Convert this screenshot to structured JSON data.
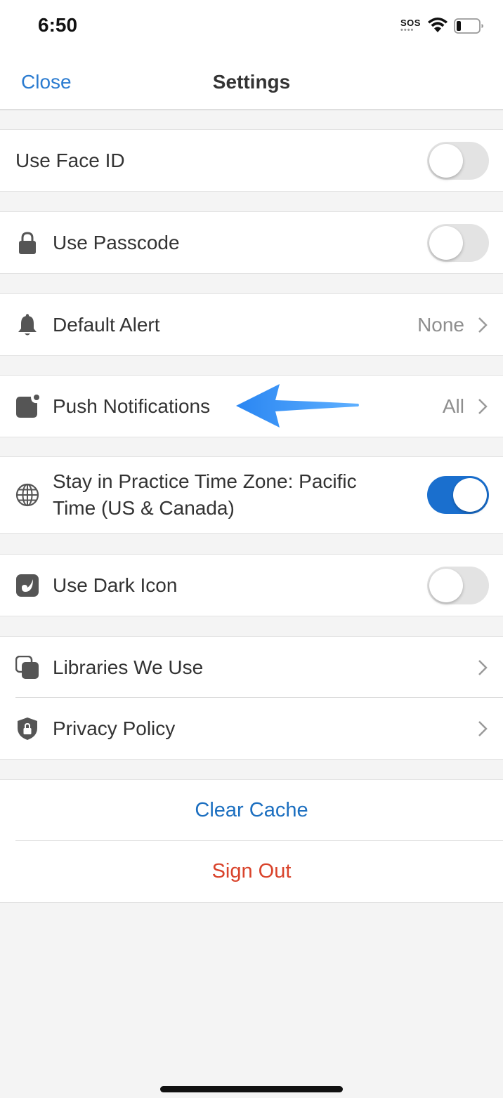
{
  "status": {
    "time": "6:50",
    "sos": "SOS",
    "battery_level": 0.2
  },
  "nav": {
    "close_label": "Close",
    "title": "Settings"
  },
  "settings": {
    "face_id": {
      "label": "Use Face ID",
      "enabled": false
    },
    "passcode": {
      "label": "Use Passcode",
      "icon": "lock-icon",
      "enabled": false
    },
    "default_alert": {
      "label": "Default Alert",
      "icon": "bell-icon",
      "value": "None"
    },
    "push_notifications": {
      "label": "Push Notifications",
      "icon": "notification-badge-icon",
      "value": "All"
    },
    "time_zone": {
      "label": "Stay in Practice Time Zone: Pacific Time (US & Canada)",
      "icon": "globe-icon",
      "enabled": true
    },
    "dark_icon": {
      "label": "Use Dark Icon",
      "icon": "app-icon",
      "enabled": false
    },
    "libraries": {
      "label": "Libraries We Use",
      "icon": "stacked-squares-icon"
    },
    "privacy": {
      "label": "Privacy Policy",
      "icon": "shield-lock-icon"
    }
  },
  "actions": {
    "clear_cache": "Clear Cache",
    "sign_out": "Sign Out"
  },
  "colors": {
    "accent": "#2a7bd0",
    "toggle_on": "#1a6fce",
    "destructive": "#d9432b",
    "arrow": "#2f8ef5"
  }
}
